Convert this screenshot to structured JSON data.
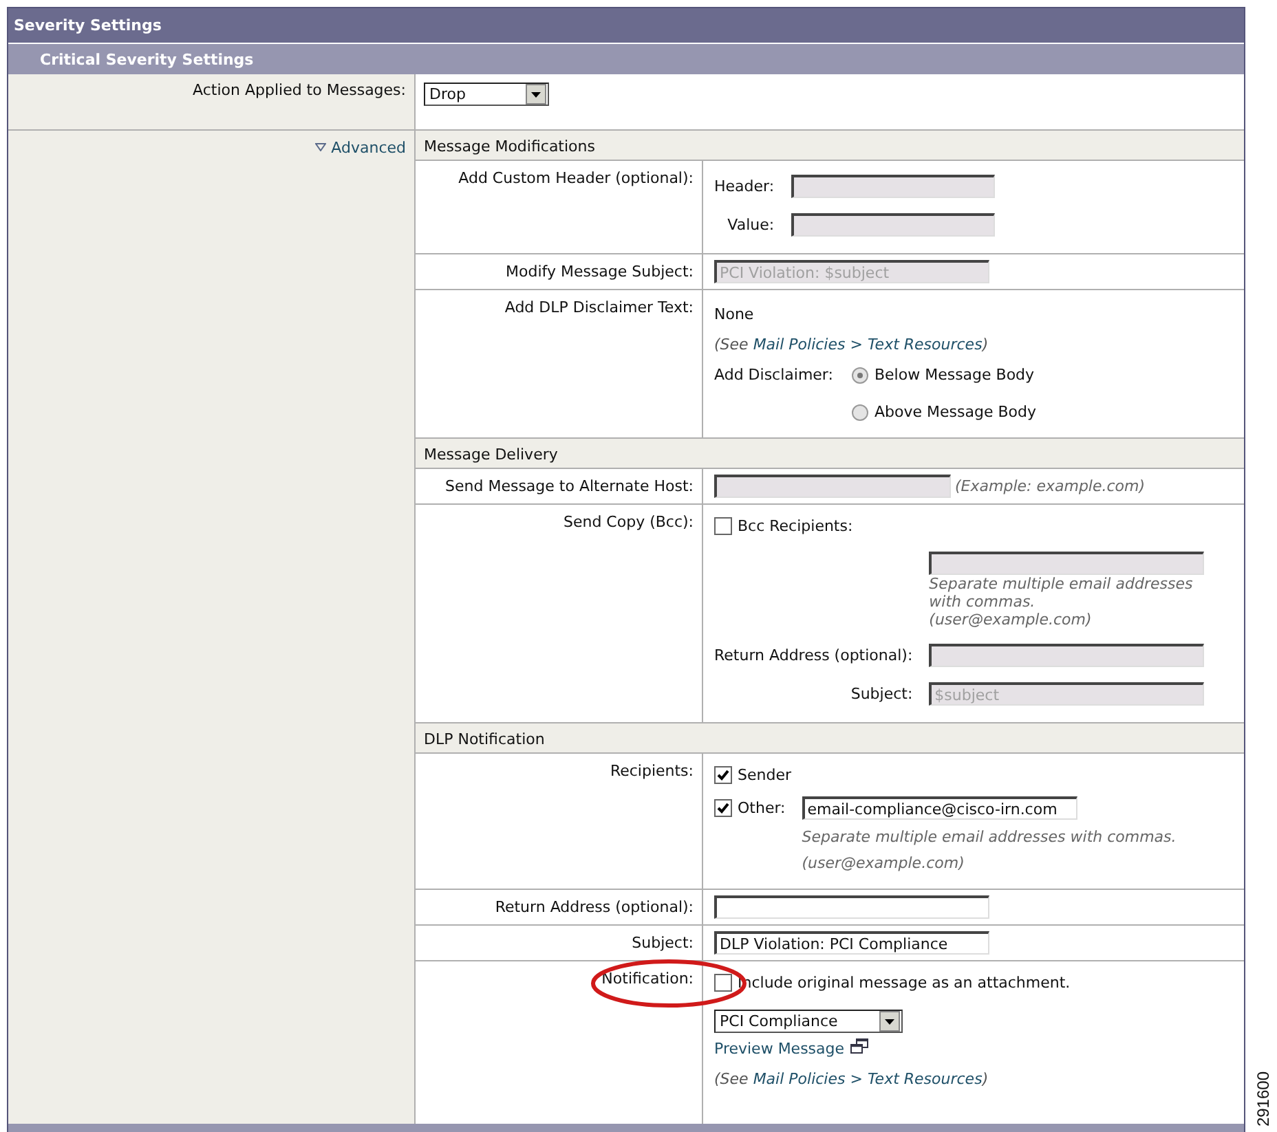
{
  "panel": {
    "title": "Severity Settings"
  },
  "section": {
    "title": "Critical Severity Settings"
  },
  "action": {
    "label": "Action Applied to Messages:",
    "select": "Drop"
  },
  "advanced": {
    "label": "Advanced",
    "expanded": true
  },
  "groups": [
    {
      "title": "Message Modifications",
      "rows": [
        {
          "label": "Add Custom Header (optional):",
          "items": [
            {
              "kind": "field",
              "label": "Header:",
              "input": {
                "disabled": true
              }
            },
            {
              "kind": "field",
              "label": "Value:",
              "input": {
                "disabled": true
              }
            }
          ]
        },
        {
          "label": "Modify Message Subject:",
          "items": [
            {
              "kind": "input",
              "input": {
                "value": "PCI Violation: $subject",
                "disabled": true
              }
            }
          ]
        },
        {
          "label": "Add DLP Disclaimer Text:",
          "items": [
            {
              "kind": "text",
              "text": "None"
            },
            {
              "kind": "note",
              "parts": [
                {
                  "text": "(See "
                },
                {
                  "text": "Mail Policies > Text Resources",
                  "link": true
                },
                {
                  "text": ")"
                }
              ]
            },
            {
              "kind": "radio",
              "label": "Add Disclaimer:",
              "options": [
                {
                  "label": "Below Message Body",
                  "selected": true
                },
                {
                  "label": "Above Message Body",
                  "selected": false
                }
              ]
            }
          ]
        }
      ]
    },
    {
      "title": "Message Delivery",
      "rows": [
        {
          "label": "Send Message to Alternate Host:",
          "items": [
            {
              "kind": "input",
              "input": {
                "disabled": true
              },
              "hint": "(Example: example.com)"
            }
          ]
        },
        {
          "label": "Send Copy (Bcc):",
          "items": [
            {
              "kind": "checkbox",
              "label": "Bcc Recipients:",
              "checked": false
            },
            {
              "kind": "field",
              "input": {
                "disabled": true
              },
              "hints": [
                "Separate multiple email addresses with commas.",
                "(user@example.com)"
              ]
            },
            {
              "kind": "field",
              "label": "Return Address (optional):",
              "input": {
                "disabled": true
              }
            },
            {
              "kind": "field",
              "label": "Subject:",
              "input": {
                "value": "$subject",
                "disabled": true
              }
            }
          ]
        }
      ]
    },
    {
      "title": "DLP Notification",
      "rows": [
        {
          "label": "Recipients:",
          "items": [
            {
              "kind": "checkbox",
              "label": "Sender",
              "checked": true
            },
            {
              "kind": "checkbox",
              "label": "Other:",
              "checked": true,
              "input": {
                "value": "email-compliance@cisco-irn.com",
                "disabled": false
              },
              "hints": [
                "Separate multiple email addresses with commas.",
                "(user@example.com)"
              ]
            }
          ]
        },
        {
          "label": "Return Address (optional):",
          "items": [
            {
              "kind": "input",
              "input": {
                "disabled": false
              }
            }
          ]
        },
        {
          "label": "Subject:",
          "items": [
            {
              "kind": "input",
              "input": {
                "value": "DLP Violation: PCI Compliance",
                "disabled": false
              }
            }
          ]
        },
        {
          "label": "Notification:",
          "circled": true,
          "items": [
            {
              "kind": "checkbox",
              "label": "Include original message as an attachment.",
              "checked": false
            },
            {
              "kind": "select",
              "value": "PCI Compliance"
            },
            {
              "kind": "link",
              "text": "Preview Message"
            },
            {
              "kind": "note",
              "parts": [
                {
                  "text": "(See "
                },
                {
                  "text": "Mail Policies > Text Resources",
                  "link": true
                },
                {
                  "text": ")"
                }
              ]
            }
          ]
        }
      ]
    }
  ],
  "figure_id": "291600"
}
